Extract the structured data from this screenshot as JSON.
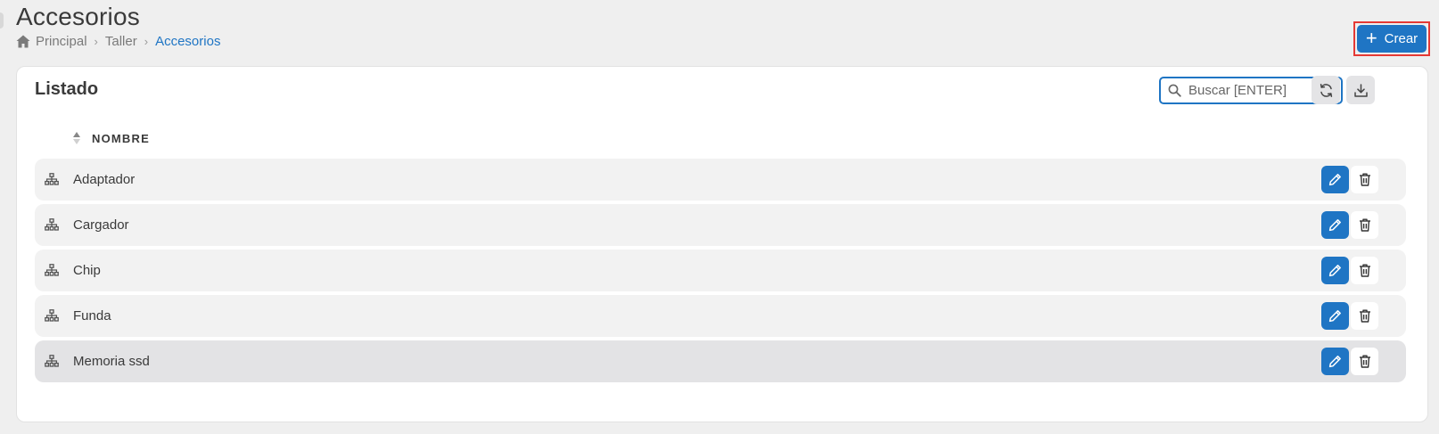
{
  "page": {
    "title": "Accesorios"
  },
  "breadcrumb": {
    "items": [
      "Principal",
      "Taller",
      "Accesorios"
    ],
    "separator": "›"
  },
  "header": {
    "create_label": "Crear"
  },
  "card": {
    "title": "Listado",
    "search_placeholder": "Buscar [ENTER]"
  },
  "table": {
    "column_header": "NOMBRE",
    "rows": [
      {
        "name": "Adaptador"
      },
      {
        "name": "Cargador"
      },
      {
        "name": "Chip"
      },
      {
        "name": "Funda"
      },
      {
        "name": "Memoria ssd"
      }
    ]
  },
  "colors": {
    "accent": "#1f75c4",
    "highlight_border": "#e53935",
    "row_bg": "#f2f2f2",
    "row_hover_bg": "#e3e3e5"
  },
  "icons": {
    "home": "home-icon",
    "plus": "plus-icon",
    "search": "search-icon",
    "refresh": "refresh-icon",
    "download": "download-icon",
    "sort": "sort-icon",
    "row": "sitemap-icon",
    "edit": "pencil-icon",
    "delete": "trash-icon"
  }
}
